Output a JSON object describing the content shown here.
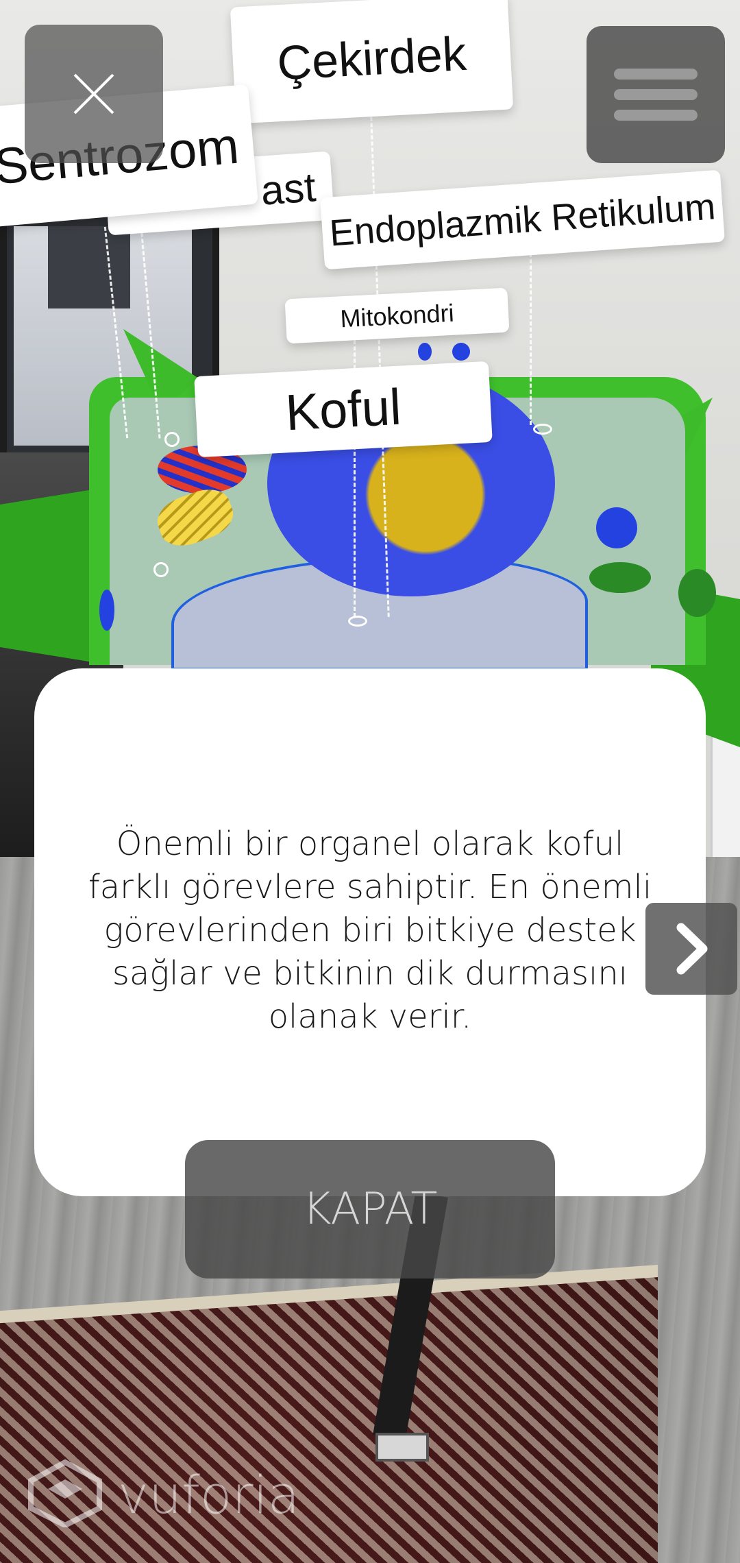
{
  "labels": {
    "cekirdek": "Çekirdek",
    "sentrozom": "Sentrozom",
    "kloroplast": "ast",
    "endoplazmik_retikulum": "Endoplazmik Retikulum",
    "mitokondri": "Mitokondri",
    "koful": "Koful"
  },
  "close_button": {
    "icon": "close-icon"
  },
  "menu_button": {
    "icon": "menu-icon"
  },
  "info_card": {
    "text": "Önemli bir organel olarak koful farklı görevlere sahiptir. En önemli görevlerinden biri bitkiye destek sağlar ve bitkinin dik durmasını olanak verir."
  },
  "next_button": {
    "icon": "chevron-right-icon"
  },
  "kapat_button": {
    "label": "KAPAT"
  },
  "watermark": {
    "text": "vuforia",
    "icon": "vuforia-logo-icon"
  },
  "colors": {
    "button_bg": "#505050",
    "card_bg": "#ffffff",
    "cell_wall": "#3fbf2c",
    "organelle_blue": "#2442e0"
  }
}
